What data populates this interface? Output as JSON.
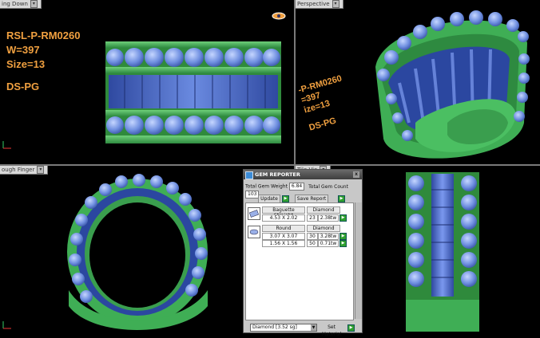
{
  "viewports": {
    "top_left": {
      "label": "ing Down"
    },
    "top_right": {
      "label": "Perspective"
    },
    "bottom_left": {
      "label": "ough Finger"
    },
    "bottom_mid": {
      "label": "Tile Vie"
    }
  },
  "ring_info": {
    "line1": "RSL-P-RM0260",
    "line2": "W=397",
    "line3": "Size=13",
    "line4": "DS-PG"
  },
  "persp_info": {
    "line1": "-P-RM0260",
    "line2": "=397",
    "line3": "ize=13",
    "line4": "DS-PG"
  },
  "gem_reporter": {
    "title": "GEM REPORTER",
    "close": "x",
    "total_weight_label": "Total Gem Weight",
    "total_weight_value": "6.84",
    "total_count_label": "Total Gem Count",
    "total_count_value": "103",
    "update_label": "Update",
    "save_report_label": "Save Report",
    "rows": [
      {
        "shape": "Baguette Straight",
        "material": "Diamond",
        "size": "4.53 X 2.02",
        "count": "23",
        "weight": "2.38tw"
      },
      {
        "shape": "Round",
        "material": "Diamond",
        "size": "3.07 X 3.07",
        "count": "30",
        "weight": "3.28tw",
        "size2": "1.56 X 1.56",
        "count2": "50",
        "weight2": "0.71tw"
      }
    ],
    "material_select": "Diamond  [3.52 sg]",
    "set_material_label": "Set Material"
  },
  "colors": {
    "metal_green": "#3fae55",
    "gem_blue": "#5e7fd6",
    "label_orange": "#f0a040"
  }
}
